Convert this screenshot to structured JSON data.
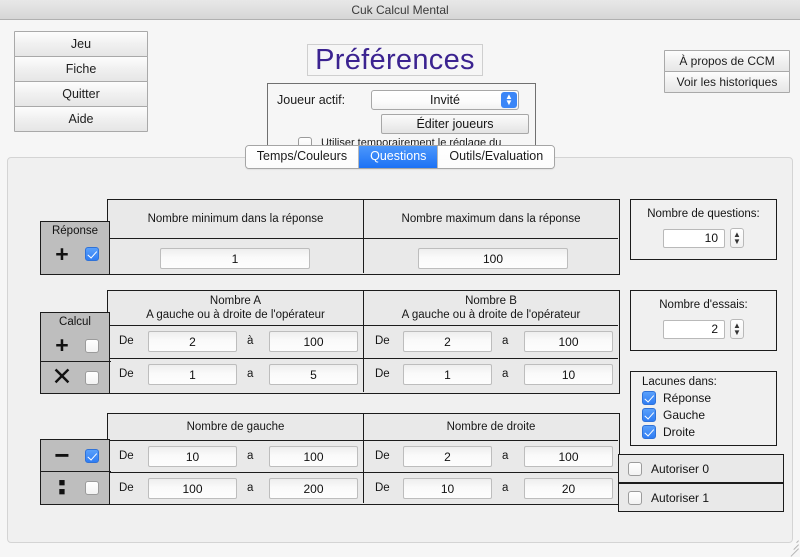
{
  "window": {
    "title": "Cuk Calcul Mental"
  },
  "header": {
    "prefs_title": "Préférences",
    "prefs_title_color": "#3b2390",
    "side_buttons": [
      {
        "label": "Jeu",
        "name": "jeu"
      },
      {
        "label": "Fiche",
        "name": "fiche"
      },
      {
        "label": "Quitter",
        "name": "quitter"
      },
      {
        "label": "Aide",
        "name": "aide"
      }
    ],
    "right_buttons": [
      {
        "label": "À propos de CCM",
        "name": "a-propos"
      },
      {
        "label": "Voir les historiques",
        "name": "historiques"
      }
    ],
    "player_box": {
      "label": "Joueur actif:",
      "selected": "Invité",
      "edit_button": "Éditer joueurs",
      "temp_checkbox_label": "Utiliser temporairement le réglage du joueur actif pour tous les joueurs",
      "temp_checkbox_checked": false
    }
  },
  "tabs": [
    {
      "label": "Temps/Couleurs",
      "active": false
    },
    {
      "label": "Questions",
      "active": true
    },
    {
      "label": "Outils/Evaluation",
      "active": false
    }
  ],
  "tab_accent": "#1c72f5",
  "reponse_block": {
    "row_caption": "Réponse",
    "operator": "+",
    "checked": true,
    "col1_header": "Nombre minimum dans la réponse",
    "col2_header": "Nombre maximum dans la réponse",
    "col1_value": "1",
    "col2_value": "100"
  },
  "calcul_block": {
    "row_caption": "Calcul",
    "col1_header_line1": "Nombre A",
    "col1_header_line2": "A gauche ou à droite de l'opérateur",
    "col2_header_line1": "Nombre B",
    "col2_header_line2": "A gauche ou à droite de l'opérateur",
    "rows": [
      {
        "operator": "+",
        "operator_name": "plus",
        "checked": false,
        "a_prefix": "De",
        "a_from": "2",
        "a_sep": "à",
        "a_to": "100",
        "b_prefix": "De",
        "b_from": "2",
        "b_sep": "a",
        "b_to": "100"
      },
      {
        "operator": "✕",
        "operator_name": "times",
        "checked": false,
        "a_prefix": "De",
        "a_from": "1",
        "a_sep": "a",
        "a_to": "5",
        "b_prefix": "De",
        "b_from": "1",
        "b_sep": "a",
        "b_to": "10"
      }
    ]
  },
  "gauche_droite_block": {
    "col1_header": "Nombre de gauche",
    "col2_header": "Nombre de droite",
    "rows": [
      {
        "operator": "—",
        "operator_name": "minus",
        "checked": true,
        "a_prefix": "De",
        "a_from": "10",
        "a_sep": "a",
        "a_to": "100",
        "b_prefix": "De",
        "b_from": "2",
        "b_sep": "a",
        "b_to": "100"
      },
      {
        "operator": ":",
        "operator_name": "divide",
        "checked": false,
        "a_prefix": "De",
        "a_from": "100",
        "a_sep": "a",
        "a_to": "200",
        "b_prefix": "De",
        "b_from": "10",
        "b_sep": "a",
        "b_to": "20"
      }
    ]
  },
  "questions_box": {
    "title": "Nombre de questions:",
    "value": "10"
  },
  "essais_box": {
    "title": "Nombre d'essais:",
    "value": "2"
  },
  "lacunes_box": {
    "title": "Lacunes dans:",
    "items": [
      {
        "label": "Réponse",
        "checked": true
      },
      {
        "label": "Gauche",
        "checked": true
      },
      {
        "label": "Droite",
        "checked": true
      }
    ]
  },
  "autoriser": [
    {
      "label": "Autoriser 0",
      "checked": false
    },
    {
      "label": "Autoriser 1",
      "checked": false
    }
  ]
}
